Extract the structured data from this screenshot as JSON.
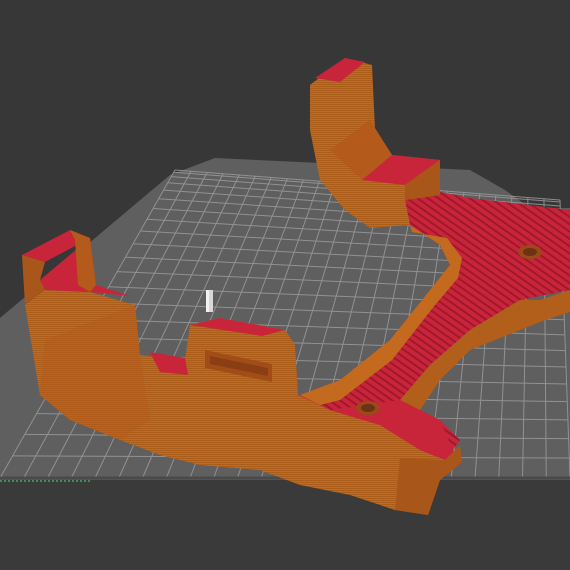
{
  "viewport": {
    "colors": {
      "background": "#373737",
      "bed": "#5f5f5f",
      "bed_grid": "#9a9a9a",
      "bed_edge": "#4a4a4a",
      "bed_front_strip": "#2f2f2f",
      "origin_marker": "#3fa66a",
      "wall": "#c46a1e",
      "wall_shade": "#a9561a",
      "infill": "#c8243a",
      "infill_dark": "#a81e33",
      "wipe_tower": "#d8d8d8"
    },
    "model": {
      "name": "printed-bracket-part",
      "features": [
        "left-tower",
        "right-tower",
        "center-tab",
        "diagonal-arm",
        "screw-hole-near",
        "screw-hole-far"
      ]
    }
  }
}
